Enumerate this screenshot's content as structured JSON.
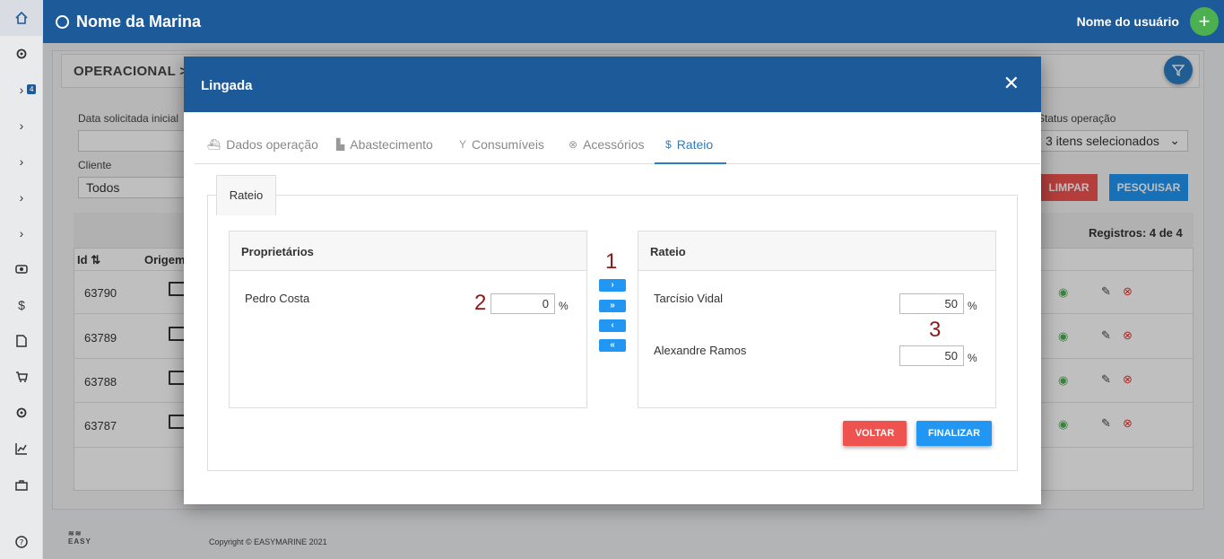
{
  "app": {
    "brand": "Nome da Marina",
    "user": "Nome do usuário",
    "add_symbol": "+"
  },
  "sidebar": {
    "badge": "4",
    "items": [
      "home-icon",
      "gear-icon",
      "chevron-right-icon",
      "chevron-right-icon",
      "chevron-right-icon",
      "chevron-right-icon",
      "chevron-right-icon",
      "eye-icon",
      "dollar-icon",
      "file-icon",
      "cart-icon",
      "gear-icon",
      "chart-icon",
      "briefcase-icon",
      "help-icon"
    ]
  },
  "page": {
    "title": "OPERACIONAL >",
    "fields": {
      "data_label": "Data solicitada inicial",
      "cliente_label": "Cliente",
      "cliente_value": "Todos",
      "status_label": "Status operação",
      "status_value": "3 itens selecionados"
    },
    "buttons": {
      "limpar": "LIMPAR",
      "pesquisar": "PESQUISAR"
    },
    "registros": "Registros: 4 de 4",
    "columns": {
      "id": "Id",
      "origem": "Origem"
    },
    "rows": [
      {
        "id": "63790"
      },
      {
        "id": "63789"
      },
      {
        "id": "63788"
      },
      {
        "id": "63787"
      }
    ],
    "footer": {
      "copyright": "Copyright © EASYMARINE 2021",
      "logo": "EASY"
    }
  },
  "modal": {
    "title": "Lingada",
    "close": "✕",
    "tabs": [
      {
        "label": "Dados operação",
        "icon": "ship-icon"
      },
      {
        "label": "Abastecimento",
        "icon": "fuel-icon"
      },
      {
        "label": "Consumíveis",
        "icon": "glass-icon"
      },
      {
        "label": "Acessórios",
        "icon": "x-circle-icon"
      },
      {
        "label": "Rateio",
        "icon": "dollar-icon",
        "active": true
      }
    ],
    "section_tab": "Rateio",
    "proprietarios": {
      "title": "Proprietários",
      "items": [
        {
          "name": "Pedro Costa",
          "value": "0"
        }
      ]
    },
    "rateio": {
      "title": "Rateio",
      "items": [
        {
          "name": "Tarcísio Vidal",
          "value": "50"
        },
        {
          "name": "Alexandre Ramos",
          "value": "50"
        }
      ]
    },
    "percent": "%",
    "markers": [
      "1",
      "2",
      "3"
    ],
    "arrows": [
      "›",
      "»",
      "‹",
      "«"
    ],
    "buttons": {
      "voltar": "VOLTAR",
      "finalizar": "FINALIZAR"
    },
    "colors": {
      "primary": "#1d5a99",
      "accent": "#2196f3",
      "danger": "#ef5350"
    }
  }
}
